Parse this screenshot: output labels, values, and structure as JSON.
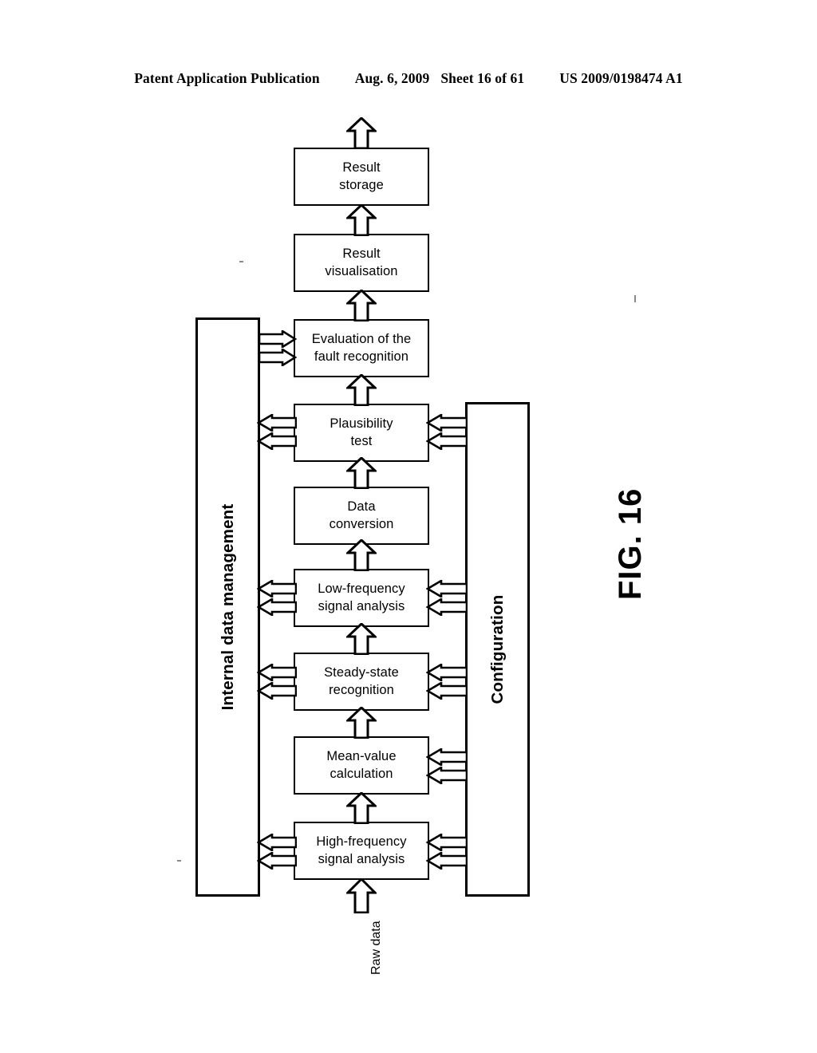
{
  "header": {
    "publication": "Patent Application Publication",
    "date": "Aug. 6, 2009",
    "sheet": "Sheet 16 of 61",
    "number": "US 2009/0198474 A1"
  },
  "figure": {
    "label": "FIG. 16",
    "input_label": "Raw data",
    "left_panel": {
      "label": "Internal data management"
    },
    "right_panel": {
      "label": "Configuration"
    },
    "blocks": [
      {
        "id": "result-storage",
        "line1": "Result",
        "line2": "storage"
      },
      {
        "id": "result-visualisation",
        "line1": "Result",
        "line2": "visualisation"
      },
      {
        "id": "evaluation-fault",
        "line1": "Evaluation of the",
        "line2": "fault recognition"
      },
      {
        "id": "plausibility-test",
        "line1": "Plausibility",
        "line2": "test"
      },
      {
        "id": "data-conversion",
        "line1": "Data",
        "line2": "conversion"
      },
      {
        "id": "low-frequency",
        "line1": "Low-frequency",
        "line2": "signal analysis"
      },
      {
        "id": "steady-state",
        "line1": "Steady-state",
        "line2": "recognition"
      },
      {
        "id": "mean-value",
        "line1": "Mean-value",
        "line2": "calculation"
      },
      {
        "id": "high-frequency",
        "line1": "High-frequency",
        "line2": "signal analysis"
      }
    ],
    "colors": {
      "ink": "#000000",
      "paper": "#ffffff"
    }
  }
}
